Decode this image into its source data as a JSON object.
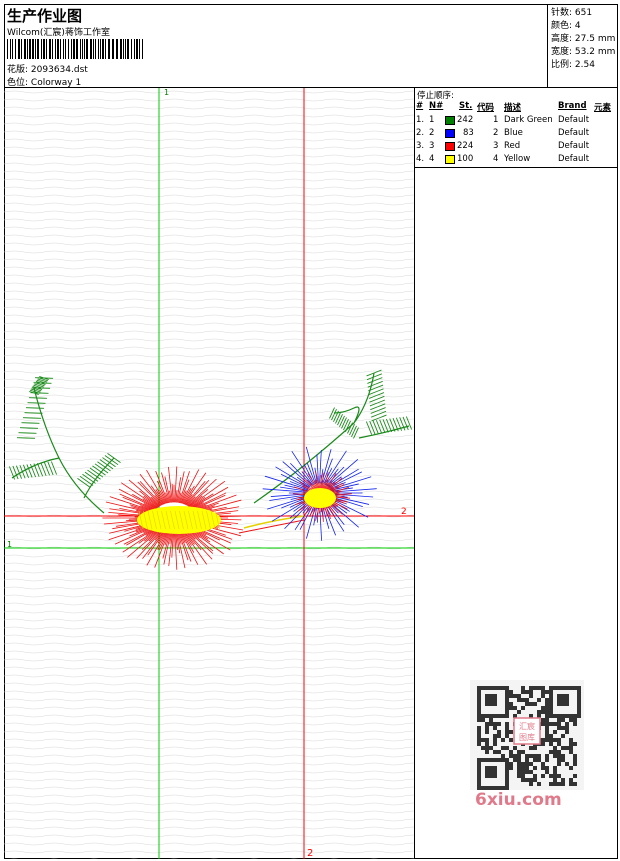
{
  "header": {
    "title": "生产作业图",
    "company": "Wilcom(汇宸)蒋饰工作室",
    "design_label": "花版:",
    "design_value": "2093634.dst",
    "colorway_label": "色位:",
    "colorway_value": "Colorway 1"
  },
  "stats": [
    {
      "label": "针数:",
      "value": "651"
    },
    {
      "label": "颜色:",
      "value": "4"
    },
    {
      "label": "高度:",
      "value": "27.5 mm"
    },
    {
      "label": "宽度:",
      "value": "53.2 mm"
    },
    {
      "label": "比例:",
      "value": "2.54"
    }
  ],
  "design": {
    "marker_1_top": "1",
    "marker_1_left": "1",
    "marker_2_right": "2",
    "marker_2_bottom": "2"
  },
  "stop_table": {
    "title": "停止顺序:",
    "headers": [
      "#",
      "N#",
      "St.",
      "代码",
      "描述",
      "Brand",
      "元素"
    ],
    "rows": [
      {
        "idx": "1.",
        "n": "1",
        "color": "#008000",
        "st": "242",
        "code": "1",
        "desc": "Dark Green",
        "brand": "Default"
      },
      {
        "idx": "2.",
        "n": "2",
        "color": "#0000ff",
        "st": "83",
        "code": "2",
        "desc": "Blue",
        "brand": "Default"
      },
      {
        "idx": "3.",
        "n": "3",
        "color": "#ff0000",
        "st": "224",
        "code": "3",
        "desc": "Red",
        "brand": "Default"
      },
      {
        "idx": "4.",
        "n": "4",
        "color": "#ffff00",
        "st": "100",
        "code": "4",
        "desc": "Yellow",
        "brand": "Default"
      }
    ]
  },
  "watermark": {
    "text": "6xiu.com",
    "stamp": "汇宸图库"
  }
}
